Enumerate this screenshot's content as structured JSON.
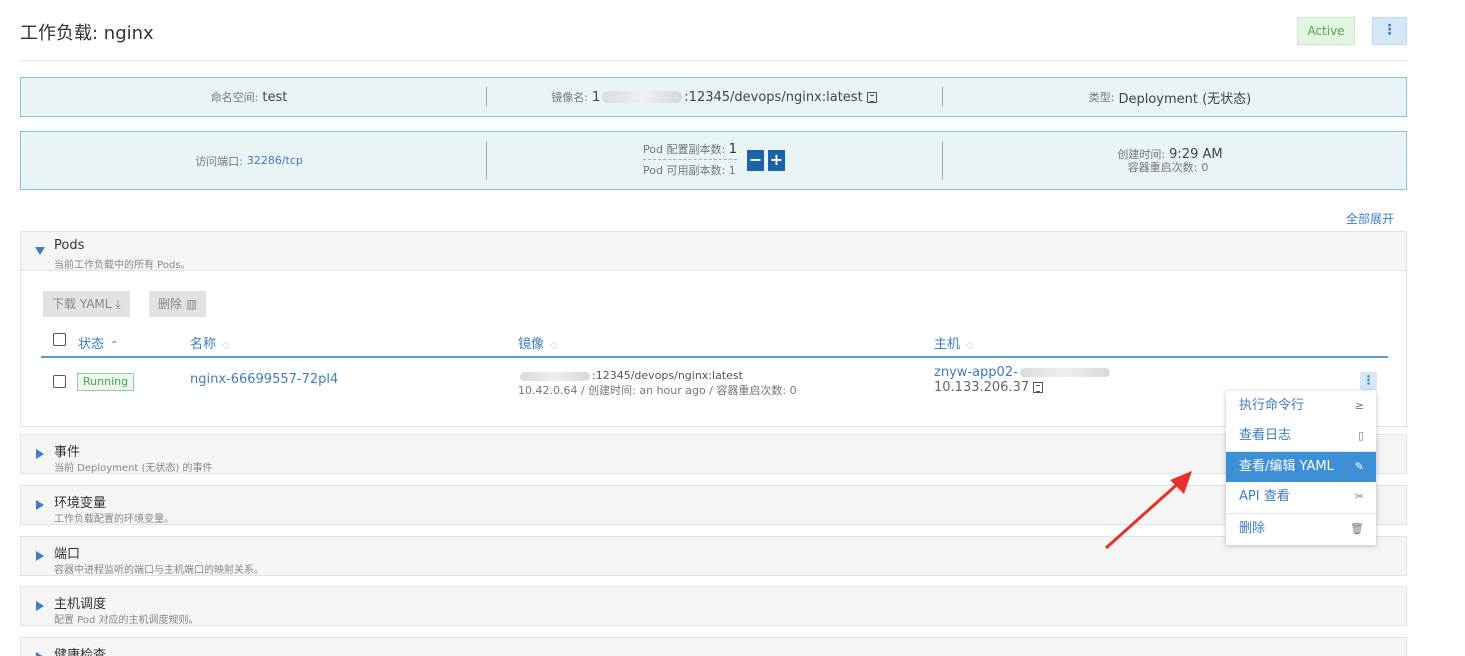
{
  "header": {
    "title": "工作负载: nginx",
    "status": "Active",
    "menu_glyph": "⋮"
  },
  "info_row1": {
    "namespace_label": "命名空间:",
    "namespace_value": "test",
    "image_label": "镜像名:",
    "image_prefix": "1",
    "image_value": ":12345/devops/nginx:latest",
    "type_label": "类型:",
    "type_value": "Deployment (无状态)"
  },
  "info_row2": {
    "port_label": "访问端口:",
    "port_value": "32286/tcp",
    "scale_label": "Pod 配置副本数:",
    "scale_value": "1",
    "available_label": "Pod 可用副本数:",
    "available_value": "1",
    "minus": "−",
    "plus": "+",
    "created_label": "创建时间:",
    "created_value": "9:29 AM",
    "restarts_label": "容器重启次数:",
    "restarts_value": "0"
  },
  "expand_all": "全部展开",
  "pods": {
    "title": "Pods",
    "subtitle": "当前工作负载中的所有 Pods。",
    "download_yaml": "下载 YAML",
    "delete": "删除",
    "columns": {
      "state": "状态",
      "name": "名称",
      "image": "镜像",
      "host": "主机"
    },
    "row": {
      "state": "Running",
      "name": "nginx-66699557-72pl4",
      "image": ":12345/devops/nginx:latest",
      "image_detail": "10.42.0.64 / 创建时间: an hour ago / 容器重启次数: 0",
      "host_name": "znyw-app02-",
      "host_ip": "10.133.206.37"
    }
  },
  "sections": [
    {
      "title": "事件",
      "subtitle": "当前 Deployment (无状态) 的事件"
    },
    {
      "title": "环境变量",
      "subtitle": "工作负载配置的环境变量。"
    },
    {
      "title": "端口",
      "subtitle": "容器中进程监听的端口与主机端口的映射关系。"
    },
    {
      "title": "主机调度",
      "subtitle": "配置 Pod 对应的主机调度规则。"
    },
    {
      "title": "健康检查",
      "subtitle": ""
    }
  ],
  "context_menu": {
    "items": [
      {
        "label": "执行命令行",
        "icon": "≥"
      },
      {
        "label": "查看日志",
        "icon": "▯"
      },
      {
        "label": "查看/编辑 YAML",
        "icon": "✎"
      },
      {
        "label": "API 查看",
        "icon": "✂"
      },
      {
        "label": "删除",
        "icon": "🗑"
      }
    ]
  },
  "colors": {
    "accent": "#3d7cc4",
    "info_bg": "#e8f4f6",
    "active_green": "#4aa54a",
    "menu_selected": "#3d8fd6",
    "arrow": "#e8302a"
  }
}
